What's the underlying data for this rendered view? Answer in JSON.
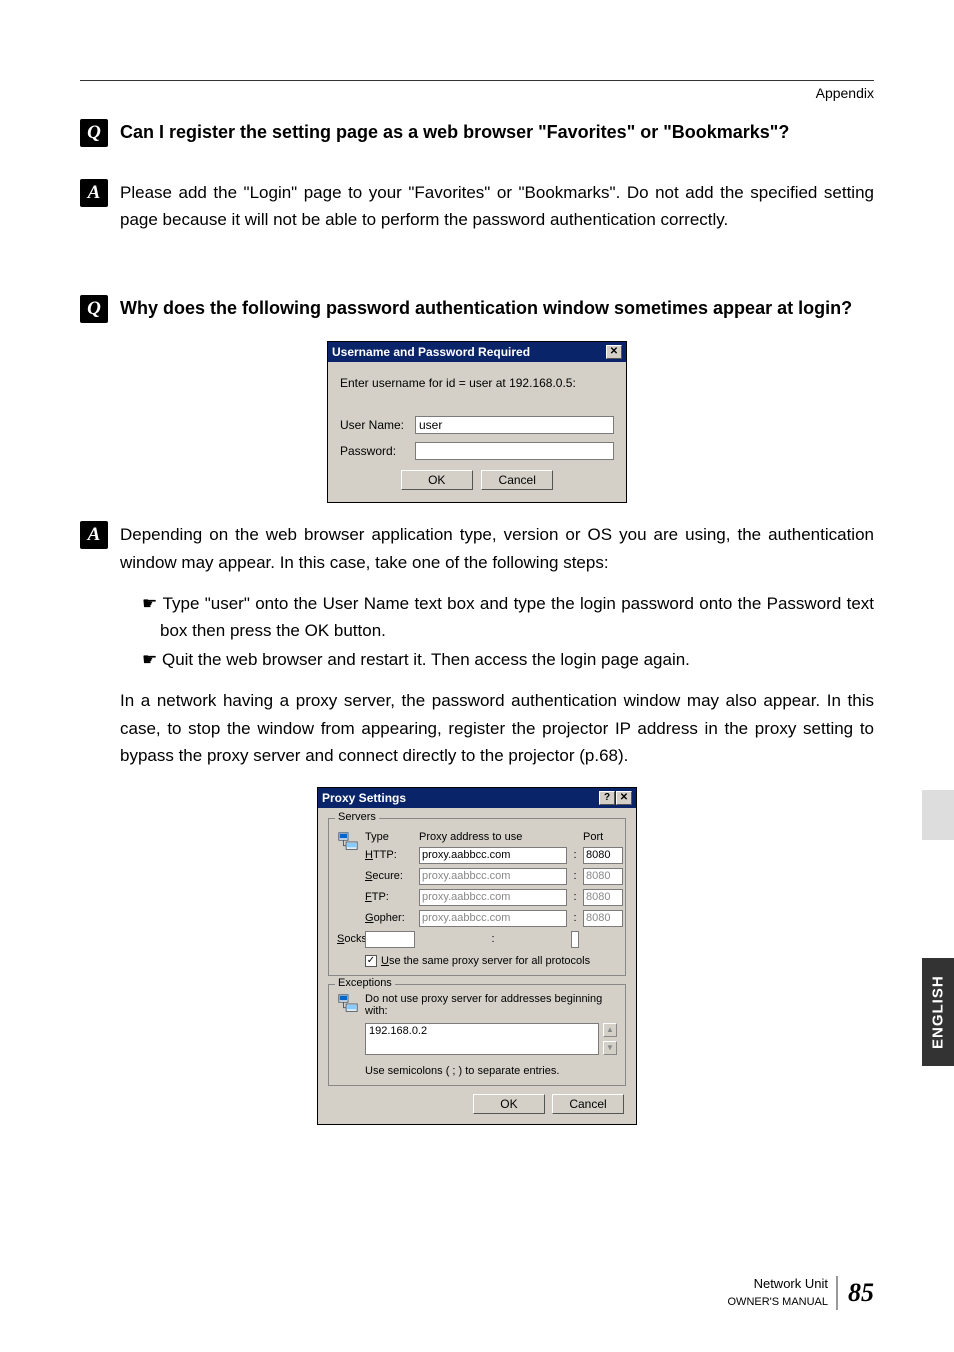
{
  "header": {
    "section": "Appendix"
  },
  "qa": [
    {
      "q_icon": "Q",
      "a_icon": "A",
      "question": "Can I register the setting page as a web browser \"Favorites\" or \"Bookmarks\"?",
      "answer": "Please add the \"Login\" page to your \"Favorites\" or \"Bookmarks\". Do not add the specified setting page because it will not be able to perform the password authentication correctly."
    },
    {
      "q_icon": "Q",
      "a_icon": "A",
      "question": "Why does the following password authentication window sometimes appear at login?",
      "answer_intro": "Depending on the web browser application type, version or OS you are using, the authentication window may appear. In this case, take one of the following steps:",
      "bullets": [
        {
          "pre": "Type \"user\" onto the ",
          "b1": "User Name",
          "mid": " text box and type the login password onto the ",
          "b2": "Password",
          "mid2": " text box then press the ",
          "b3": "OK",
          "end": " button."
        },
        {
          "text": "Quit the web browser and restart it. Then access the login page again."
        }
      ],
      "answer_extra": "In a network having a proxy server, the password authentication window may also appear. In this case, to stop the window from appearing, register the projector IP address in the proxy setting to bypass the proxy server and connect directly to the projector (p.68)."
    }
  ],
  "dialog1": {
    "title": "Username and Password Required",
    "message": "Enter username for id = user at 192.168.0.5:",
    "username_label": "User Name:",
    "username_value": "user",
    "password_label": "Password:",
    "password_value": "",
    "ok": "OK",
    "cancel": "Cancel"
  },
  "dialog2": {
    "title": "Proxy Settings",
    "servers_legend": "Servers",
    "col_type": "Type",
    "col_addr": "Proxy address to use",
    "col_port": "Port",
    "rows": [
      {
        "label": "HTTP:",
        "addr": "proxy.aabbcc.com",
        "port": "8080",
        "active": true
      },
      {
        "label": "Secure:",
        "addr": "proxy.aabbcc.com",
        "port": "8080",
        "active": false
      },
      {
        "label": "FTP:",
        "addr": "proxy.aabbcc.com",
        "port": "8080",
        "active": false
      },
      {
        "label": "Gopher:",
        "addr": "proxy.aabbcc.com",
        "port": "8080",
        "active": false
      },
      {
        "label": "Socks:",
        "addr": "",
        "port": "",
        "active": false
      }
    ],
    "same_proxy": "Use the same proxy server for all protocols",
    "exceptions_legend": "Exceptions",
    "exc_label": "Do not use proxy server for addresses beginning with:",
    "exc_value": "192.168.0.2",
    "exc_help": "Use semicolons ( ; ) to separate entries.",
    "ok": "OK",
    "cancel": "Cancel"
  },
  "side_tab": "ENGLISH",
  "footer": {
    "line1": "Network Unit",
    "line2": "OWNER'S MANUAL",
    "page": "85"
  }
}
